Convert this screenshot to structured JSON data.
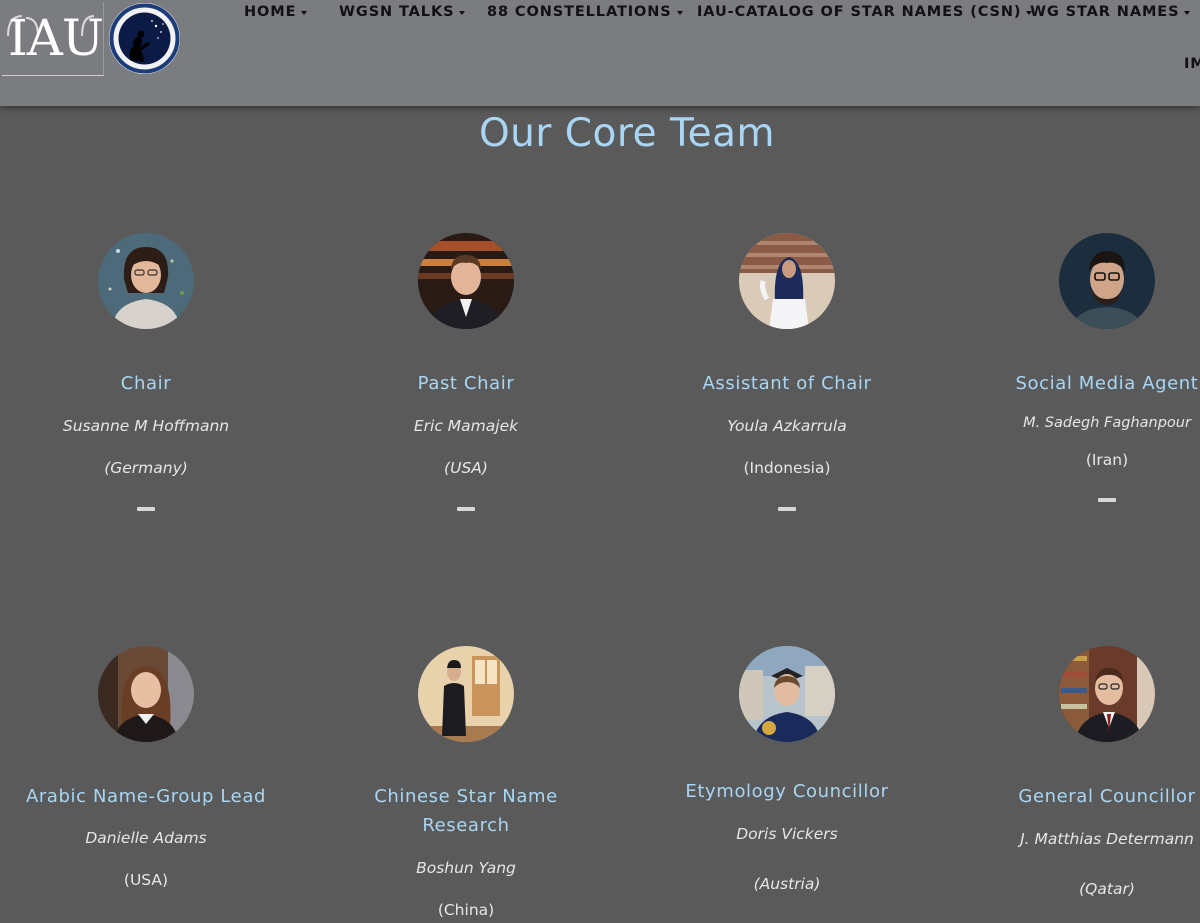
{
  "header": {
    "logo_text": "IAU",
    "nav": [
      {
        "label": "HOME"
      },
      {
        "label": "WGSN TALKS"
      },
      {
        "label": "88 CONSTELLATIONS"
      },
      {
        "label": "IAU-CATALOG OF STAR NAMES (CSN)"
      },
      {
        "label": "WG STAR NAMES"
      }
    ],
    "nav_overflow": "IM"
  },
  "page_title": "Our Core Team",
  "members": [
    {
      "role": "Chair",
      "name": "Susanne M Hoffmann",
      "country": "(Germany)"
    },
    {
      "role": "Past Chair",
      "name": "Eric Mamajek",
      "country": "(USA)"
    },
    {
      "role": "Assistant of Chair",
      "name": "Youla Azkarrula",
      "country": "(Indonesia)"
    },
    {
      "role": "Social Media Agent",
      "name": "M. Sadegh Faghanpour",
      "country": "(Iran)"
    },
    {
      "role": "Arabic Name-Group Lead",
      "name": "Danielle Adams",
      "country": "(USA)"
    },
    {
      "role_line1": "Chinese Star Name",
      "role_line2": "Research",
      "name": "Boshun Yang",
      "country": "(China)"
    },
    {
      "role": "Etymology Councillor",
      "name": "Doris Vickers",
      "country": "(Austria)"
    },
    {
      "role": "General Councillor",
      "name": "J. Matthias Determann",
      "country": "(Qatar)"
    }
  ],
  "colors": {
    "background": "#5a5a5a",
    "header": "#7b7c80",
    "accent": "#a8d6f4",
    "text": "#e6e6e6"
  }
}
